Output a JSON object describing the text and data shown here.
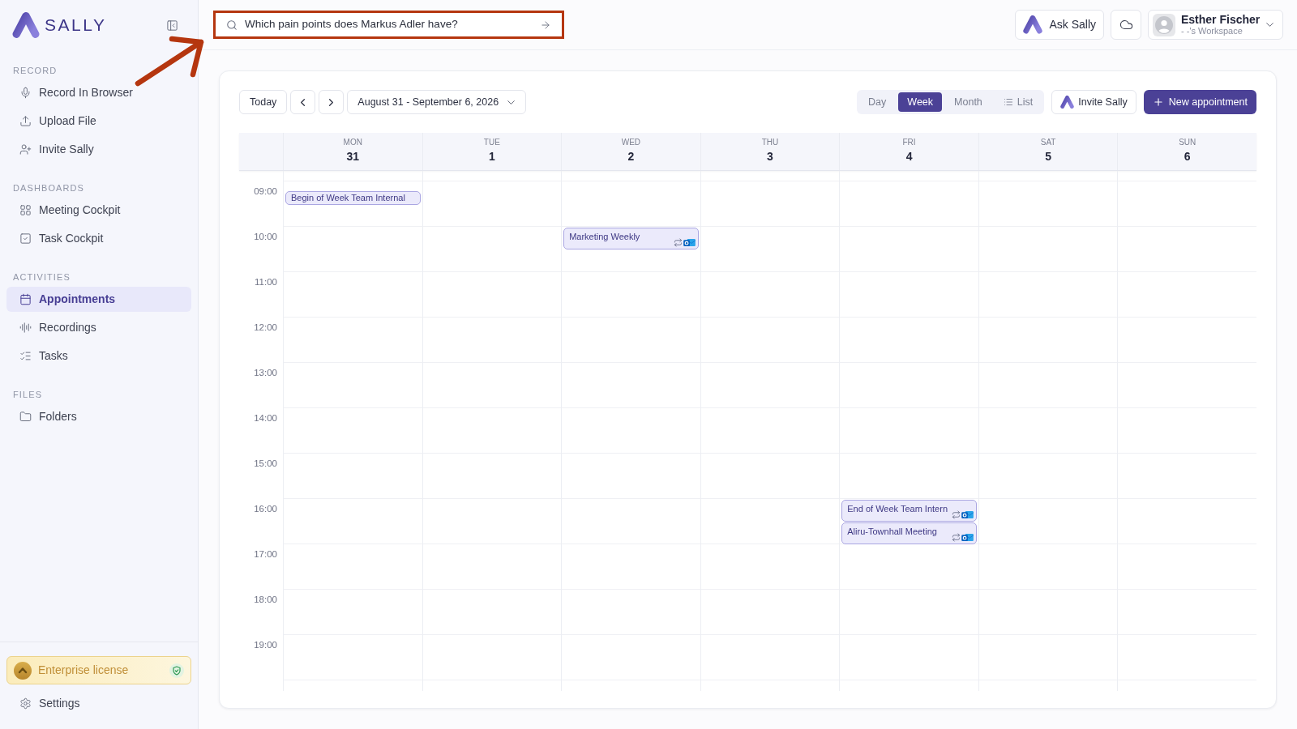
{
  "sidebar": {
    "brand": "SALLY",
    "sections": [
      {
        "title": "RECORD",
        "items": [
          {
            "label": "Record In Browser",
            "selected": false
          },
          {
            "label": "Upload File",
            "selected": false
          },
          {
            "label": "Invite Sally",
            "selected": false
          }
        ]
      },
      {
        "title": "DASHBOARDS",
        "items": [
          {
            "label": "Meeting Cockpit",
            "selected": false
          },
          {
            "label": "Task Cockpit",
            "selected": false
          }
        ]
      },
      {
        "title": "ACTIVITIES",
        "items": [
          {
            "label": "Appointments",
            "selected": true
          },
          {
            "label": "Recordings",
            "selected": false
          },
          {
            "label": "Tasks",
            "selected": false
          }
        ]
      },
      {
        "title": "FILES",
        "items": [
          {
            "label": "Folders",
            "selected": false
          }
        ]
      }
    ],
    "license": "Enterprise license",
    "settings": "Settings"
  },
  "topbar": {
    "search": {
      "value": "Which pain points does Markus Adler have?",
      "highlighted": true
    },
    "ask_button": "Ask Sally",
    "user": {
      "name": "Esther Fischer",
      "workspace": "- -'s Workspace"
    }
  },
  "calendar": {
    "today_button": "Today",
    "date_range": "August 31 - September 6, 2026",
    "views": [
      {
        "label": "Day",
        "selected": false
      },
      {
        "label": "Week",
        "selected": true
      },
      {
        "label": "Month",
        "selected": false
      },
      {
        "label": "List",
        "selected": false
      }
    ],
    "invite_button": "Invite Sally",
    "new_button": "New appointment",
    "days": [
      {
        "weekday": "MON",
        "date": "31"
      },
      {
        "weekday": "TUE",
        "date": "1"
      },
      {
        "weekday": "WED",
        "date": "2"
      },
      {
        "weekday": "THU",
        "date": "3"
      },
      {
        "weekday": "FRI",
        "date": "4"
      },
      {
        "weekday": "SAT",
        "date": "5"
      },
      {
        "weekday": "SUN",
        "date": "6"
      }
    ],
    "hours": [
      {
        "label": "09:00",
        "cells": [
          {
            "events": [
              {
                "kind": "compact",
                "title": "Begin of Week Team Internal",
                "recurring": false,
                "external_calendar": false
              }
            ]
          },
          {},
          {},
          {},
          {},
          {},
          {}
        ]
      },
      {
        "label": "10:00",
        "cells": [
          {},
          {},
          {
            "events": [
              {
                "kind": "block",
                "title": "Marketing Weekly",
                "recurring": true,
                "external_calendar": true
              }
            ]
          },
          {},
          {},
          {},
          {}
        ]
      },
      {
        "label": "11:00"
      },
      {
        "label": "12:00"
      },
      {
        "label": "13:00"
      },
      {
        "label": "14:00"
      },
      {
        "label": "15:00"
      },
      {
        "label": "16:00",
        "cells": [
          {},
          {},
          {},
          {},
          {
            "events": [
              {
                "kind": "block",
                "title": "End of Week Team Intern",
                "recurring": true,
                "external_calendar": true
              },
              {
                "kind": "block",
                "title": "Aliru-Townhall Meeting",
                "recurring": true,
                "external_calendar": true
              }
            ]
          },
          {},
          {}
        ]
      },
      {
        "label": "17:00"
      },
      {
        "label": "18:00"
      },
      {
        "label": "19:00"
      }
    ]
  }
}
